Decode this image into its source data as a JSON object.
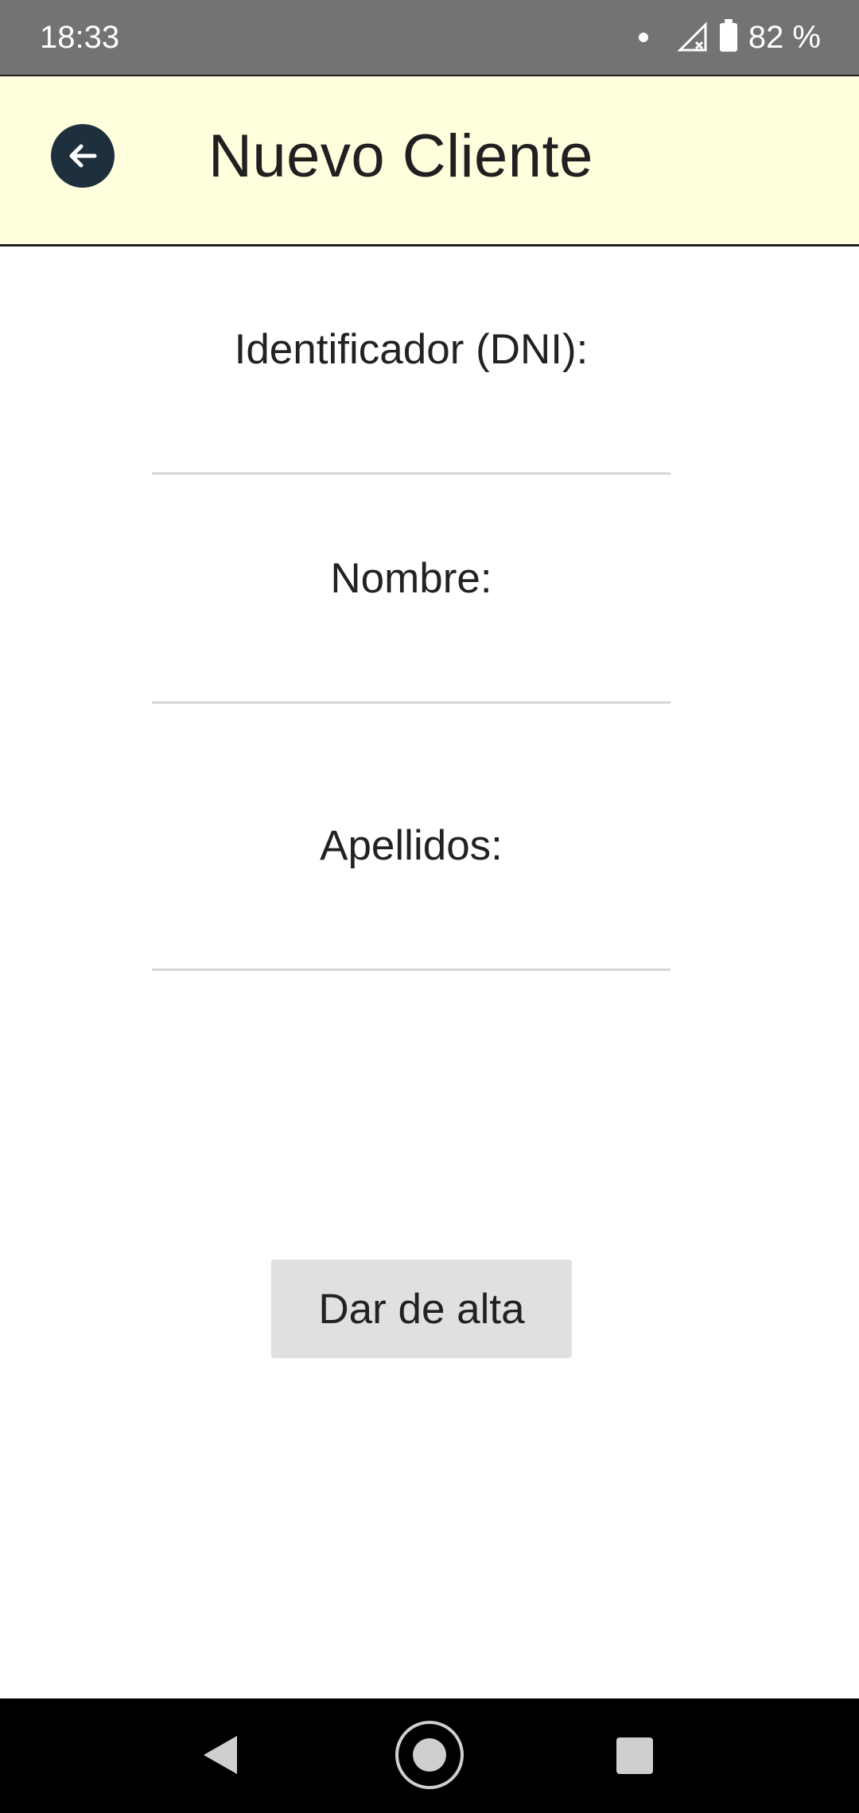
{
  "status_bar": {
    "time": "18:33",
    "battery": "82 %",
    "icons": [
      "notification-dot-icon",
      "signal-no-data-icon",
      "battery-icon"
    ]
  },
  "app_bar": {
    "title": "Nuevo Cliente",
    "back_icon": "arrow-left-icon",
    "background_color": "#ffffdd",
    "back_button_color": "#1e2f3d"
  },
  "form": {
    "fields": [
      {
        "label": "Identificador (DNI):",
        "value": "",
        "placeholder": ""
      },
      {
        "label": "Nombre:",
        "value": "",
        "placeholder": ""
      },
      {
        "label": "Apellidos:",
        "value": "",
        "placeholder": ""
      }
    ],
    "submit_label": "Dar de alta"
  },
  "nav_bar": {
    "icons": [
      "back-triangle-icon",
      "home-circle-icon",
      "recents-square-icon"
    ]
  }
}
